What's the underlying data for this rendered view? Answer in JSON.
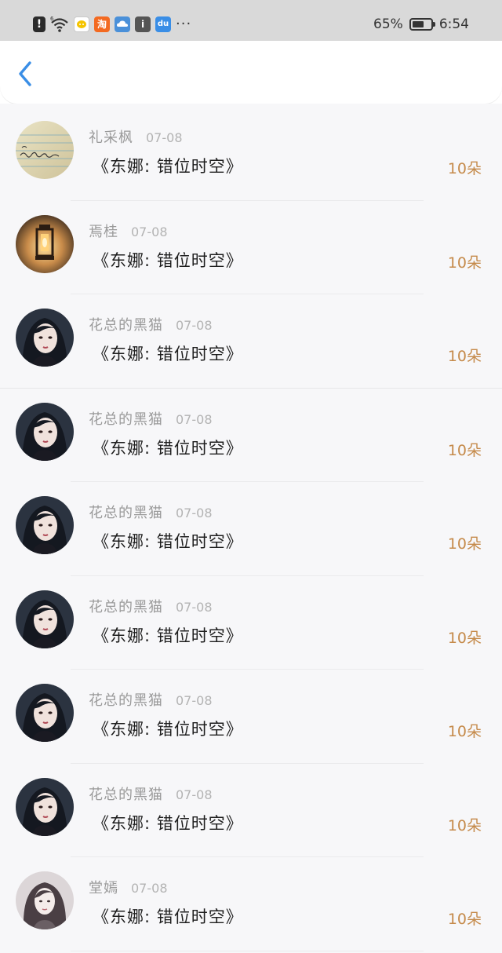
{
  "status_bar": {
    "signal_label": "6",
    "battery_percent": "65%",
    "battery_level": 0.65,
    "time": "6:54",
    "notification_icons": [
      "alert-icon",
      "wifi-icon",
      "chat-app-icon",
      "taobao-app-icon",
      "cloud-app-icon",
      "info-app-icon",
      "du-app-icon"
    ],
    "taobao_glyph": "淘",
    "info_glyph": "i",
    "du_glyph": "du",
    "more": "···"
  },
  "header": {
    "back_icon": "chevron-left-icon",
    "accent_color": "#3a8ee6"
  },
  "colors": {
    "count": "#c58a4a",
    "name": "#9a9a9a",
    "date": "#b3b3b3",
    "title": "#1e1e1e"
  },
  "items": [
    {
      "name": "礼采枫",
      "date": "07-08",
      "title": "《东娜: 错位时空》",
      "count": "10朵",
      "avatar": "handwritten-note-avatar"
    },
    {
      "name": "焉桂",
      "date": "07-08",
      "title": "《东娜: 错位时空》",
      "count": "10朵",
      "avatar": "lantern-avatar"
    },
    {
      "name": "花总的黑猫",
      "date": "07-08",
      "title": "《东娜: 错位时空》",
      "count": "10朵",
      "avatar": "dark-hair-girl-avatar"
    },
    {
      "name": "花总的黑猫",
      "date": "07-08",
      "title": "《东娜: 错位时空》",
      "count": "10朵",
      "avatar": "dark-hair-girl-avatar"
    },
    {
      "name": "花总的黑猫",
      "date": "07-08",
      "title": "《东娜: 错位时空》",
      "count": "10朵",
      "avatar": "dark-hair-girl-avatar"
    },
    {
      "name": "花总的黑猫",
      "date": "07-08",
      "title": "《东娜: 错位时空》",
      "count": "10朵",
      "avatar": "dark-hair-girl-avatar"
    },
    {
      "name": "花总的黑猫",
      "date": "07-08",
      "title": "《东娜: 错位时空》",
      "count": "10朵",
      "avatar": "dark-hair-girl-avatar"
    },
    {
      "name": "花总的黑猫",
      "date": "07-08",
      "title": "《东娜: 错位时空》",
      "count": "10朵",
      "avatar": "dark-hair-girl-avatar"
    },
    {
      "name": "堂嫣",
      "date": "07-08",
      "title": "《东娜: 错位时空》",
      "count": "10朵",
      "avatar": "long-hair-girl-avatar"
    }
  ]
}
